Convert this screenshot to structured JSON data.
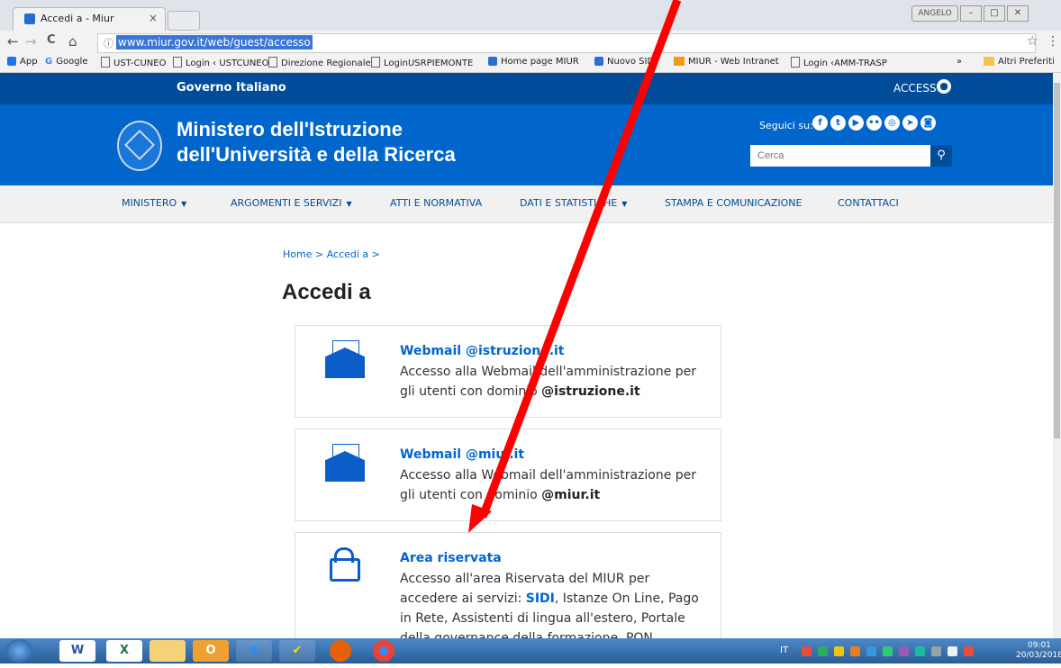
{
  "browser": {
    "tab_title": "Accedi a - Miur",
    "tab_close": "×",
    "user_badge": "ANGELO",
    "win_min": "–",
    "win_max": "□",
    "win_close": "✕",
    "url": "www.miur.gov.it/web/guest/accesso",
    "info_icon": "ⓘ",
    "back": "←",
    "forward": "→",
    "reload": "C",
    "home": "⌂",
    "star": "☆",
    "menu": "⋮"
  },
  "bookmarks": {
    "items": [
      "App",
      "Google",
      "UST-CUNEO",
      "Login ‹ USTCUNEO",
      "Direzione Regionale",
      "LoginUSRPIEMONTE",
      "Home page MIUR",
      "Nuovo SIDI",
      "MIUR - Web Intranet",
      "Login ‹AMM-TRASP"
    ],
    "more": "»",
    "other": "Altri Preferiti"
  },
  "gov_bar": {
    "title": "Governo Italiano",
    "access": "ACCESSO"
  },
  "header": {
    "line1": "Ministero dell'Istruzione",
    "line2": "dell'Università e della Ricerca",
    "follow": "Seguici su:",
    "search_placeholder": "Cerca",
    "search_icon": "⚲"
  },
  "nav": {
    "items": [
      "MINISTERO",
      "ARGOMENTI E SERVIZI",
      "ATTI E NORMATIVA",
      "DATI E STATISTICHE",
      "STAMPA E COMUNICAZIONE",
      "CONTATTACI"
    ]
  },
  "breadcrumb": "Home > Accedi a >",
  "page_title": "Accedi a",
  "cards": [
    {
      "title": "Webmail @istruzione.it",
      "desc_pre": "Accesso alla Webmail dell'amministrazione per gli utenti con dominio ",
      "desc_bold": "@istruzione.it"
    },
    {
      "title": "Webmail @miur.it",
      "desc_pre": "Accesso alla Webmail dell'amministrazione per gli utenti con dominio ",
      "desc_bold": "@miur.it"
    },
    {
      "title": "Area riservata",
      "desc_pre": "Accesso all'area Riservata del MIUR per accedere ai servizi: ",
      "desc_link": "SIDI",
      "desc_post": ", Istanze On Line, Pago in Rete, Assistenti di lingua all'estero, Portale della governance della formazione, PON Istruzione, Edilizia, Enti di..."
    }
  ],
  "taskbar": {
    "lang": "IT",
    "time": "09:01",
    "date": "20/03/2018"
  },
  "colors": {
    "gov_bar": "#004c99",
    "header": "#0066cc",
    "link": "#0066cc",
    "arrow": "#ff0000"
  }
}
